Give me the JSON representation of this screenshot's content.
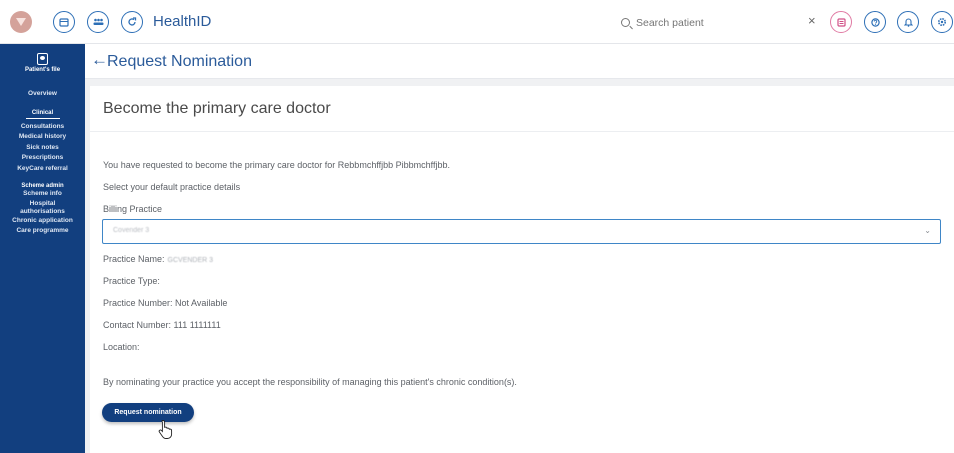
{
  "topbar": {
    "app_title": "HealthID",
    "search": {
      "placeholder": "Search patient",
      "value": ""
    },
    "icons": [
      "app-logo",
      "calendar-icon",
      "people-icon",
      "refresh-icon",
      "search-icon",
      "close-icon",
      "chat-icon",
      "help-icon",
      "bell-icon",
      "settings-icon"
    ],
    "accent_color": "#2d6fb6"
  },
  "sidebar": {
    "heading": "Patient's file",
    "overview": "Overview",
    "clinical_section": "Clinical",
    "clinical_items": [
      "Consultations",
      "Medical history",
      "Sick notes",
      "Prescriptions",
      "KeyCare referral"
    ],
    "scheme_section": "Scheme admin",
    "scheme_items": [
      "Scheme info",
      "Hospital authorisations",
      "Chronic application",
      "Care programme"
    ],
    "background_color": "#123f7f"
  },
  "header": {
    "title": "Request Nomination"
  },
  "card": {
    "title": "Become the primary care doctor",
    "intro": "You have requested to become the primary care doctor for Rebbmchffjbb Pibbmchffjbb.",
    "select_prompt": "Select your default practice details",
    "billing_label": "Billing Practice",
    "billing_value": "Covender 3",
    "practice_name_label": "Practice Name:",
    "practice_name_value": "GCVENDER 3",
    "practice_type_label": "Practice Type:",
    "practice_number": "Practice Number: Not Available",
    "contact_number": "Contact Number: 111 1111111",
    "location_label": "Location:",
    "disclaimer": "By nominating your practice you accept the responsibility of managing this patient's chronic condition(s).",
    "button_label": "Request nomination"
  }
}
